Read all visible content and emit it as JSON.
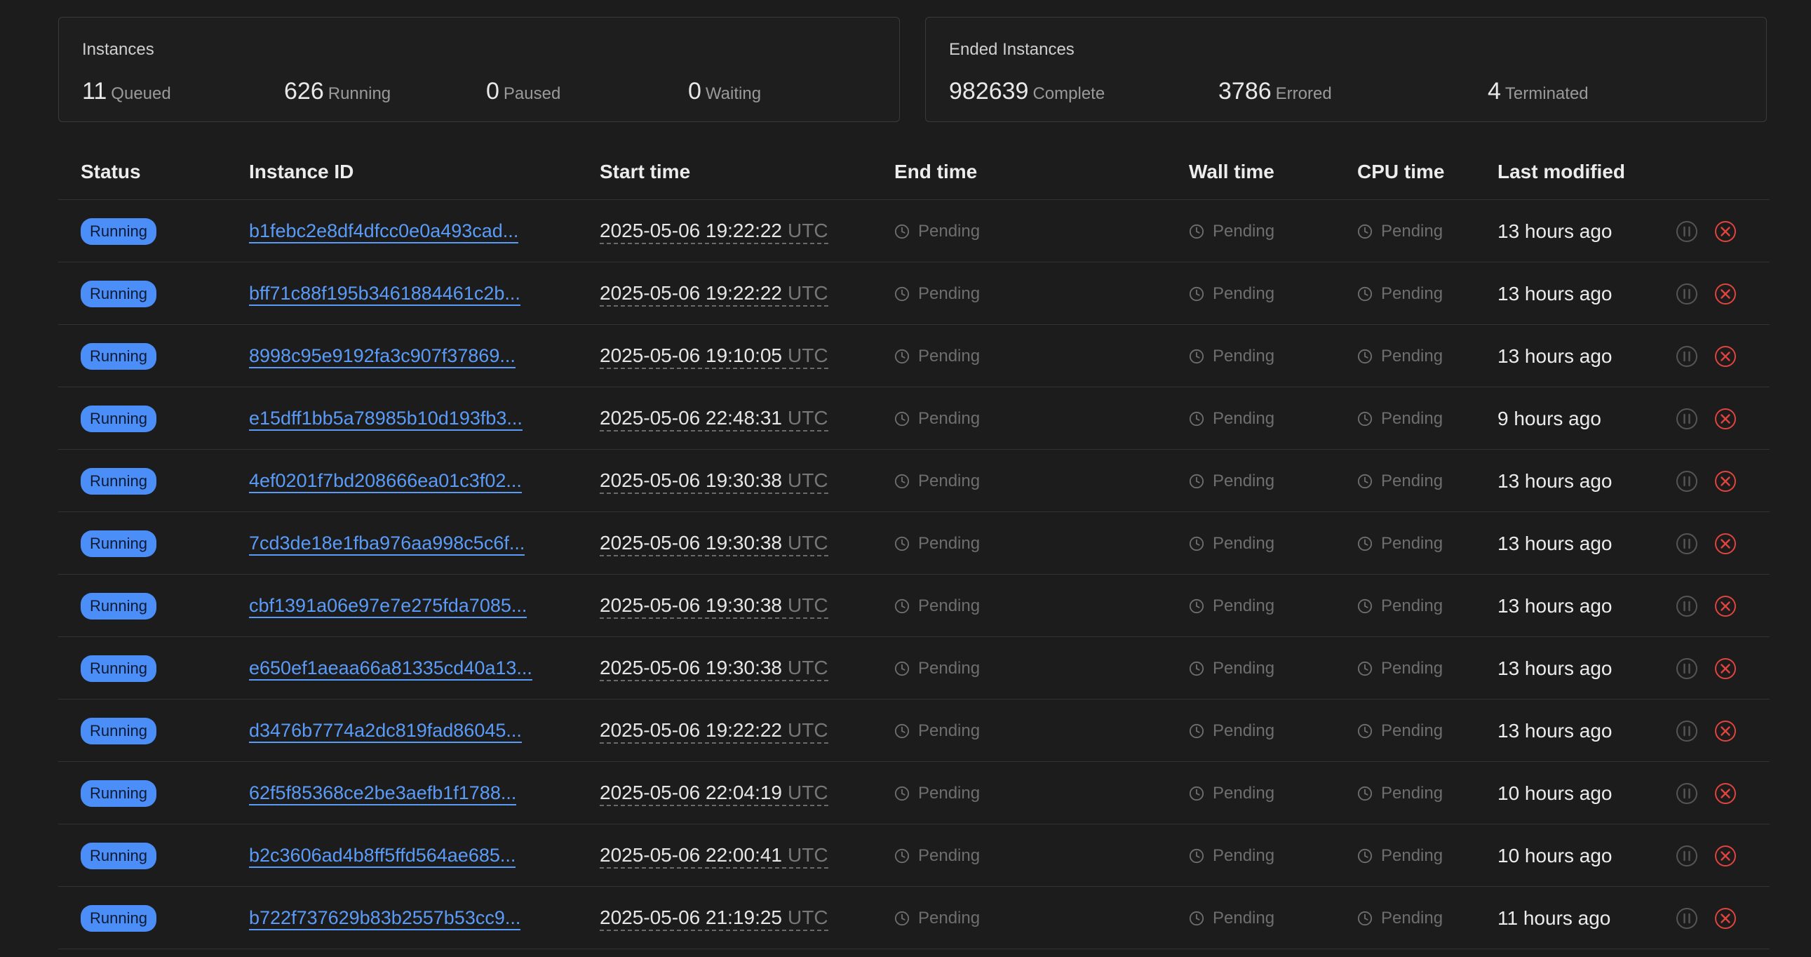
{
  "instances_card": {
    "title": "Instances",
    "stats": [
      {
        "value": "11",
        "label": "Queued"
      },
      {
        "value": "626",
        "label": "Running"
      },
      {
        "value": "0",
        "label": "Paused"
      },
      {
        "value": "0",
        "label": "Waiting"
      }
    ]
  },
  "ended_card": {
    "title": "Ended Instances",
    "stats": [
      {
        "value": "982639",
        "label": "Complete"
      },
      {
        "value": "3786",
        "label": "Errored"
      },
      {
        "value": "4",
        "label": "Terminated"
      }
    ]
  },
  "table": {
    "columns": [
      "Status",
      "Instance ID",
      "Start time",
      "End time",
      "Wall time",
      "CPU time",
      "Last modified"
    ],
    "pending_label": "Pending",
    "timezone": "UTC",
    "icons": {
      "pending": "clock-icon",
      "pause": "pause-icon",
      "terminate": "close-circle-icon"
    },
    "colors": {
      "badge": "#4c8ef7",
      "link": "#5b9bf8",
      "terminate": "#e0443e"
    },
    "rows": [
      {
        "status": "Running",
        "id": "b1febc2e8df4dfcc0e0a493cad...",
        "start": "2025-05-06 19:22:22",
        "modified": "13 hours ago"
      },
      {
        "status": "Running",
        "id": "bff71c88f195b3461884461c2b...",
        "start": "2025-05-06 19:22:22",
        "modified": "13 hours ago"
      },
      {
        "status": "Running",
        "id": "8998c95e9192fa3c907f37869...",
        "start": "2025-05-06 19:10:05",
        "modified": "13 hours ago"
      },
      {
        "status": "Running",
        "id": "e15dff1bb5a78985b10d193fb3...",
        "start": "2025-05-06 22:48:31",
        "modified": "9 hours ago"
      },
      {
        "status": "Running",
        "id": "4ef0201f7bd208666ea01c3f02...",
        "start": "2025-05-06 19:30:38",
        "modified": "13 hours ago"
      },
      {
        "status": "Running",
        "id": "7cd3de18e1fba976aa998c5c6f...",
        "start": "2025-05-06 19:30:38",
        "modified": "13 hours ago"
      },
      {
        "status": "Running",
        "id": "cbf1391a06e97e7e275fda7085...",
        "start": "2025-05-06 19:30:38",
        "modified": "13 hours ago"
      },
      {
        "status": "Running",
        "id": "e650ef1aeaa66a81335cd40a13...",
        "start": "2025-05-06 19:30:38",
        "modified": "13 hours ago"
      },
      {
        "status": "Running",
        "id": "d3476b7774a2dc819fad86045...",
        "start": "2025-05-06 19:22:22",
        "modified": "13 hours ago"
      },
      {
        "status": "Running",
        "id": "62f5f85368ce2be3aefb1f1788...",
        "start": "2025-05-06 22:04:19",
        "modified": "10 hours ago"
      },
      {
        "status": "Running",
        "id": "b2c3606ad4b8ff5ffd564ae685...",
        "start": "2025-05-06 22:00:41",
        "modified": "10 hours ago"
      },
      {
        "status": "Running",
        "id": "b722f737629b83b2557b53cc9...",
        "start": "2025-05-06 21:19:25",
        "modified": "11 hours ago"
      }
    ]
  }
}
